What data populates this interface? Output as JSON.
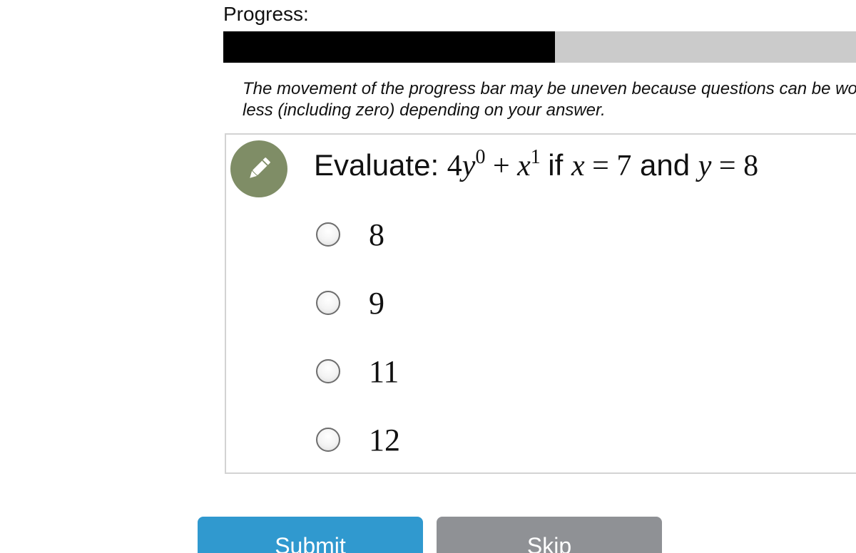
{
  "progress": {
    "label": "Progress:",
    "value_fraction": 0.524,
    "note": "The movement of the progress bar may be uneven because questions can be worth more or less (including zero) depending on your answer."
  },
  "question": {
    "prompt_prefix": "Evaluate:",
    "expression": {
      "coef": "4",
      "var1": "y",
      "exp1": "0",
      "plus": "+",
      "var2": "x",
      "exp2": "1"
    },
    "if_word": "if",
    "cond1_var": "x",
    "cond1_eq": "=",
    "cond1_val": "7",
    "and_word": "and",
    "cond2_var": "y",
    "cond2_eq": "=",
    "cond2_val": "8",
    "options": [
      {
        "label": "8"
      },
      {
        "label": "9"
      },
      {
        "label": "11"
      },
      {
        "label": "12"
      }
    ]
  },
  "buttons": {
    "submit_label": "Submit",
    "skip_label": "Skip"
  },
  "colors": {
    "progress_fill": "#000000",
    "progress_track": "#cbcbcb",
    "badge": "#7f8d66",
    "submit": "#3099cf",
    "skip": "#8f9195"
  },
  "icons": {
    "badge_icon": "pencil-icon"
  }
}
